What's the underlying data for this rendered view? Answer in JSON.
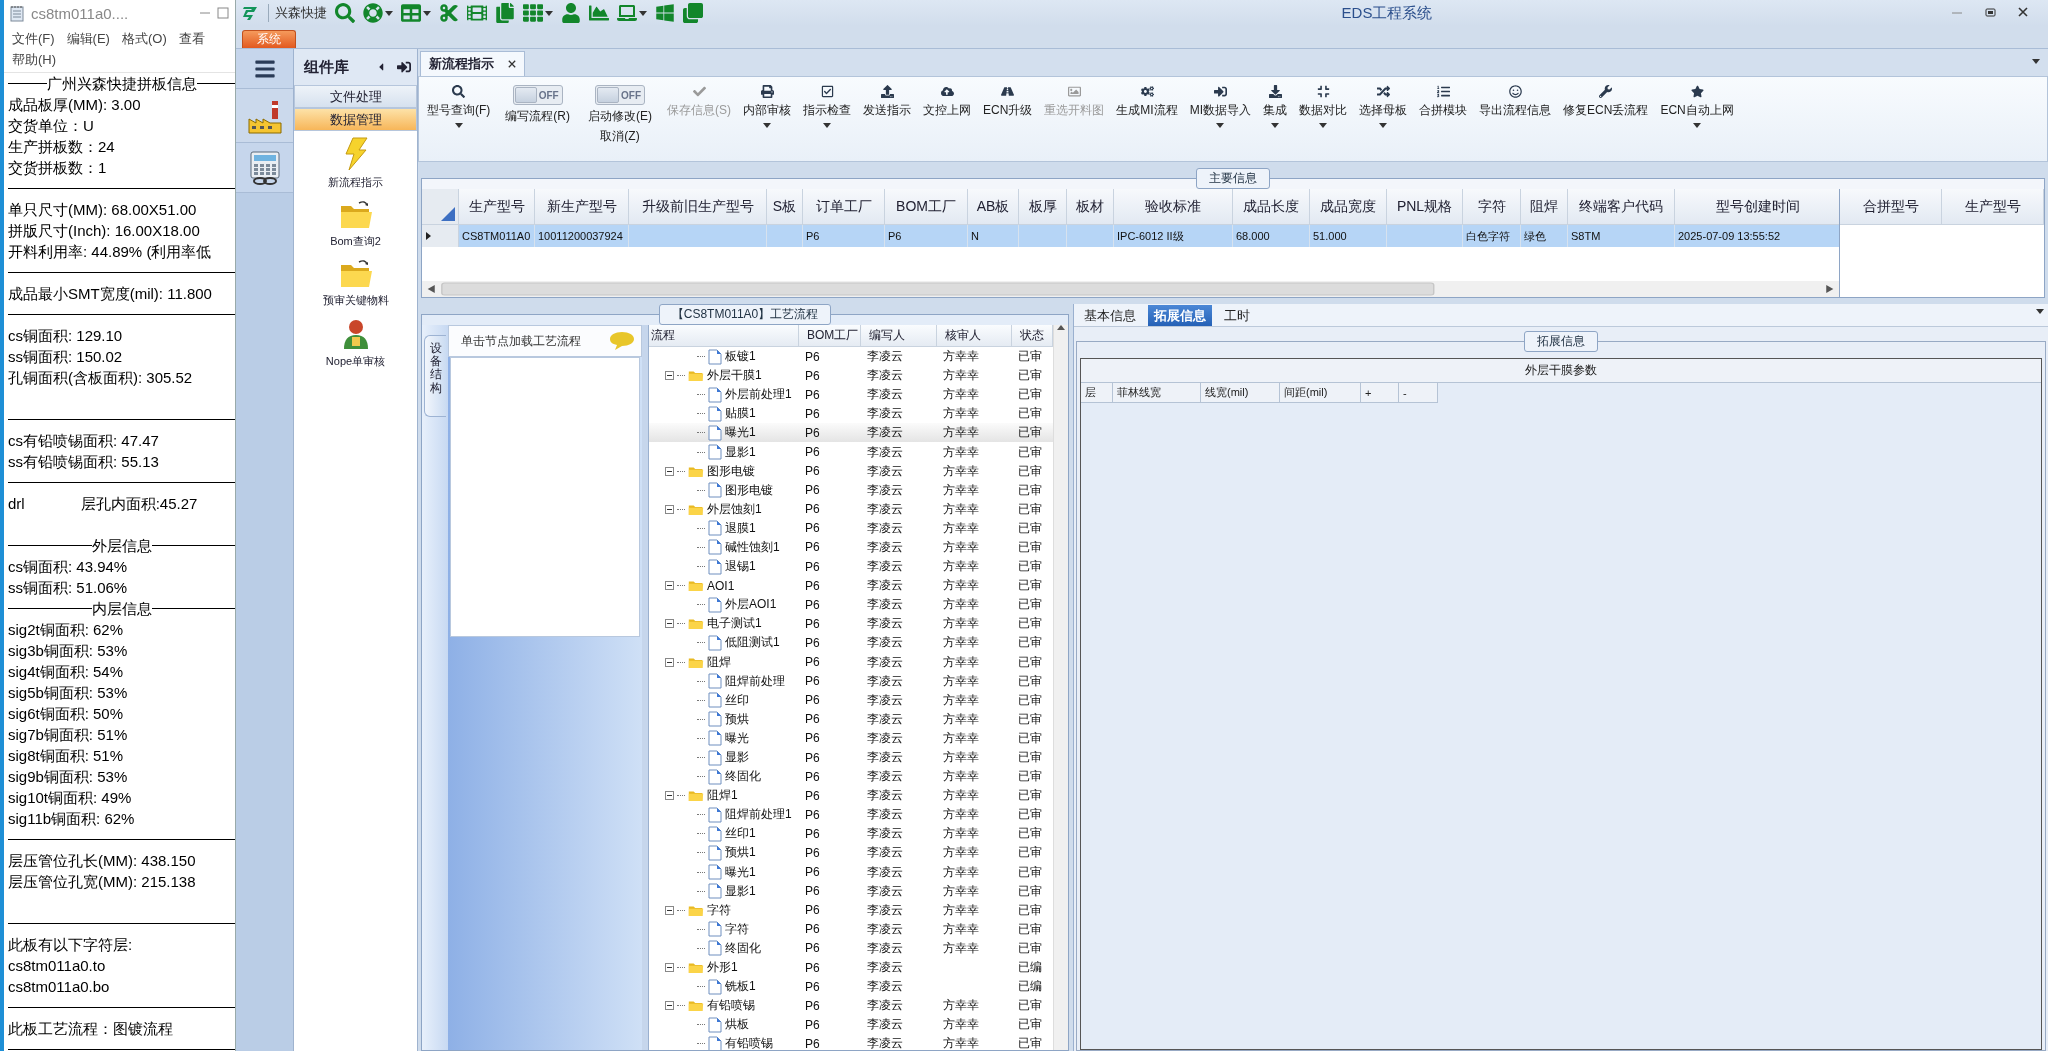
{
  "notepad": {
    "title": "cs8tm011a0....",
    "menu": [
      "文件(F)",
      "编辑(E)",
      "格式(O)",
      "查看",
      "帮助(H)"
    ],
    "lines": [
      {
        "kind": "heading",
        "text": "广州兴森快捷拼板信息"
      },
      {
        "kind": "text",
        "text": "成品板厚(MM): 3.00"
      },
      {
        "kind": "text",
        "text": "交货单位：U"
      },
      {
        "kind": "text",
        "text": "生产拼板数：24"
      },
      {
        "kind": "text",
        "text": "交货拼板数：1"
      },
      {
        "kind": "rule"
      },
      {
        "kind": "text",
        "text": "单只尺寸(MM): 68.00X51.00"
      },
      {
        "kind": "text",
        "text": "拼版尺寸(Inch): 16.00X18.00"
      },
      {
        "kind": "text",
        "text": "开料利用率: 44.89% (利用率低"
      },
      {
        "kind": "rule"
      },
      {
        "kind": "text",
        "text": "成品最小SMT宽度(mil): 11.800"
      },
      {
        "kind": "rule"
      },
      {
        "kind": "text",
        "text": "cs铜面积: 129.10"
      },
      {
        "kind": "text",
        "text": "ss铜面积: 150.02"
      },
      {
        "kind": "text",
        "text": "孔铜面积(含板面积): 305.52"
      },
      {
        "kind": "blank"
      },
      {
        "kind": "rule"
      },
      {
        "kind": "text",
        "text": "cs有铅喷锡面积: 47.47"
      },
      {
        "kind": "text",
        "text": "ss有铅喷锡面积: 55.13"
      },
      {
        "kind": "rule"
      },
      {
        "kind": "pair",
        "text": "drl",
        "value": "层孔内面积:45.27"
      },
      {
        "kind": "blank"
      },
      {
        "kind": "heading",
        "text": "外层信息"
      },
      {
        "kind": "text",
        "text": "cs铜面积: 43.94%"
      },
      {
        "kind": "text",
        "text": "ss铜面积: 51.06%"
      },
      {
        "kind": "heading",
        "text": "内层信息"
      },
      {
        "kind": "text",
        "text": "sig2t铜面积: 62%"
      },
      {
        "kind": "text",
        "text": "sig3b铜面积: 53%"
      },
      {
        "kind": "text",
        "text": "sig4t铜面积: 54%"
      },
      {
        "kind": "text",
        "text": "sig5b铜面积: 53%"
      },
      {
        "kind": "text",
        "text": "sig6t铜面积: 50%"
      },
      {
        "kind": "text",
        "text": "sig7b铜面积: 51%"
      },
      {
        "kind": "text",
        "text": "sig8t铜面积: 51%"
      },
      {
        "kind": "text",
        "text": "sig9b铜面积: 53%"
      },
      {
        "kind": "text",
        "text": "sig10t铜面积: 49%"
      },
      {
        "kind": "text",
        "text": "sig11b铜面积: 62%"
      },
      {
        "kind": "rule"
      },
      {
        "kind": "text",
        "text": "层压管位孔长(MM): 438.150"
      },
      {
        "kind": "text",
        "text": "层压管位孔宽(MM): 215.138"
      },
      {
        "kind": "blank"
      },
      {
        "kind": "rule"
      },
      {
        "kind": "text",
        "text": "此板有以下字符层:"
      },
      {
        "kind": "text",
        "text": "cs8tm011a0.to"
      },
      {
        "kind": "text",
        "text": "cs8tm011a0.bo"
      },
      {
        "kind": "rule"
      },
      {
        "kind": "text",
        "text": "此板工艺流程：图镀流程"
      },
      {
        "kind": "rule"
      }
    ]
  },
  "app": {
    "title": "EDS工程系统",
    "brand": "兴森快捷",
    "system_tab": "系统"
  },
  "component_library": {
    "title": "组件库",
    "groups": [
      {
        "label": "文件处理",
        "selected": false
      },
      {
        "label": "数据管理",
        "selected": true
      }
    ],
    "items": [
      {
        "kind": "lightning",
        "label": "新流程指示"
      },
      {
        "kind": "folder",
        "label": "Bom查询2"
      },
      {
        "kind": "folder",
        "label": "预审关键物料"
      },
      {
        "kind": "person",
        "label": "Nope单审核"
      }
    ]
  },
  "document_tabs": [
    {
      "label": "新流程指示",
      "selected": true
    }
  ],
  "ribbon": [
    {
      "kind": "button",
      "label": "型号查询(F)",
      "dropdown": true,
      "disabled": false
    },
    {
      "kind": "toggle",
      "switch_text": "OFF",
      "on": false,
      "label": "编写流程(R)"
    },
    {
      "kind": "toggle",
      "switch_text": "OFF",
      "on": false,
      "label": "启动修改(E)",
      "second_label": "取消(Z)"
    },
    {
      "kind": "button",
      "label": "保存信息(S)",
      "dropdown": false,
      "disabled": true
    },
    {
      "kind": "button",
      "label": "内部审核",
      "dropdown": true,
      "disabled": false
    },
    {
      "kind": "button",
      "label": "指示检查",
      "dropdown": true,
      "disabled": false
    },
    {
      "kind": "button",
      "label": "发送指示",
      "dropdown": false,
      "disabled": false
    },
    {
      "kind": "button",
      "label": "文控上网",
      "dropdown": false,
      "disabled": false
    },
    {
      "kind": "button",
      "label": "ECN升级",
      "dropdown": false,
      "disabled": false
    },
    {
      "kind": "button",
      "label": "重选开料图",
      "dropdown": false,
      "disabled": true
    },
    {
      "kind": "button",
      "label": "生成MI流程",
      "dropdown": false,
      "disabled": false
    },
    {
      "kind": "button",
      "label": "MI数据导入",
      "dropdown": true,
      "disabled": false
    },
    {
      "kind": "button",
      "label": "集成",
      "dropdown": true,
      "disabled": false
    },
    {
      "kind": "button",
      "label": "数据对比",
      "dropdown": true,
      "disabled": false
    },
    {
      "kind": "button",
      "label": "选择母板",
      "dropdown": true,
      "disabled": false
    },
    {
      "kind": "button",
      "label": "合拼模块",
      "dropdown": false,
      "disabled": false
    },
    {
      "kind": "button",
      "label": "导出流程信息",
      "dropdown": false,
      "disabled": false
    },
    {
      "kind": "button",
      "label": "修复ECN丢流程",
      "dropdown": false,
      "disabled": false
    },
    {
      "kind": "button",
      "label": "ECN自动上网",
      "dropdown": true,
      "disabled": false
    }
  ],
  "main_info": {
    "legend": "主要信息",
    "columns": [
      "生产型号",
      "新生产型号",
      "升级前旧生产型号",
      "S板",
      "订单工厂",
      "BOM工厂",
      "AB板",
      "板厚",
      "板材",
      "验收标准",
      "成品长度",
      "成品宽度",
      "PNL规格",
      "字符",
      "阻焊",
      "终端客户代码",
      "型号创建时间"
    ],
    "rows": [
      {
        "selected": true,
        "cells": [
          "CS8TM011A0",
          "10011200037924",
          null,
          null,
          "P6",
          "P6",
          "N",
          null,
          null,
          "IPC-6012 II级",
          "68.000",
          "51.000",
          null,
          "白色字符",
          "绿色",
          "S8TM",
          "2025-07-09 13:55:52"
        ]
      }
    ],
    "side_columns": [
      "合拼型号",
      "生产型号"
    ]
  },
  "flow": {
    "legend": "【CS8TM011A0】工艺流程",
    "side_tab": "设备结构",
    "hint": "单击节点加载工艺流程",
    "columns": [
      "流程",
      "BOM工厂",
      "编写人",
      "核审人",
      "状态"
    ],
    "tree": [
      {
        "kind": "continued",
        "children": [
          {
            "kind": "file",
            "label": "板镀1",
            "bom": "P6",
            "writer": "李凌云",
            "reviewer": "方幸幸",
            "status": "已审",
            "selected": false
          }
        ]
      },
      {
        "kind": "folder",
        "label": "外层干膜1",
        "bom": "P6",
        "writer": "李凌云",
        "reviewer": "方幸幸",
        "status": "已审",
        "expanded": true,
        "selected": false,
        "children": [
          {
            "kind": "file",
            "label": "外层前处理1",
            "bom": "P6",
            "writer": "李凌云",
            "reviewer": "方幸幸",
            "status": "已审",
            "selected": false
          },
          {
            "kind": "file",
            "label": "贴膜1",
            "bom": "P6",
            "writer": "李凌云",
            "reviewer": "方幸幸",
            "status": "已审",
            "selected": false
          },
          {
            "kind": "file",
            "label": "曝光1",
            "bom": "P6",
            "writer": "李凌云",
            "reviewer": "方幸幸",
            "status": "已审",
            "selected": true
          },
          {
            "kind": "file",
            "label": "显影1",
            "bom": "P6",
            "writer": "李凌云",
            "reviewer": "方幸幸",
            "status": "已审",
            "selected": false
          }
        ]
      },
      {
        "kind": "folder",
        "label": "图形电镀",
        "bom": "P6",
        "writer": "李凌云",
        "reviewer": "方幸幸",
        "status": "已审",
        "expanded": true,
        "selected": false,
        "children": [
          {
            "kind": "file",
            "label": "图形电镀",
            "bom": "P6",
            "writer": "李凌云",
            "reviewer": "方幸幸",
            "status": "已审",
            "selected": false
          }
        ]
      },
      {
        "kind": "folder",
        "label": "外层蚀刻1",
        "bom": "P6",
        "writer": "李凌云",
        "reviewer": "方幸幸",
        "status": "已审",
        "expanded": true,
        "selected": false,
        "children": [
          {
            "kind": "file",
            "label": "退膜1",
            "bom": "P6",
            "writer": "李凌云",
            "reviewer": "方幸幸",
            "status": "已审",
            "selected": false
          },
          {
            "kind": "file",
            "label": "碱性蚀刻1",
            "bom": "P6",
            "writer": "李凌云",
            "reviewer": "方幸幸",
            "status": "已审",
            "selected": false
          },
          {
            "kind": "file",
            "label": "退锡1",
            "bom": "P6",
            "writer": "李凌云",
            "reviewer": "方幸幸",
            "status": "已审",
            "selected": false
          }
        ]
      },
      {
        "kind": "folder",
        "label": "AOI1",
        "bom": "P6",
        "writer": "李凌云",
        "reviewer": "方幸幸",
        "status": "已审",
        "expanded": true,
        "selected": false,
        "children": [
          {
            "kind": "file",
            "label": "外层AOI1",
            "bom": "P6",
            "writer": "李凌云",
            "reviewer": "方幸幸",
            "status": "已审",
            "selected": false
          }
        ]
      },
      {
        "kind": "folder",
        "label": "电子测试1",
        "bom": "P6",
        "writer": "李凌云",
        "reviewer": "方幸幸",
        "status": "已审",
        "expanded": true,
        "selected": false,
        "children": [
          {
            "kind": "file",
            "label": "低阻测试1",
            "bom": "P6",
            "writer": "李凌云",
            "reviewer": "方幸幸",
            "status": "已审",
            "selected": false
          }
        ]
      },
      {
        "kind": "folder",
        "label": "阻焊",
        "bom": "P6",
        "writer": "李凌云",
        "reviewer": "方幸幸",
        "status": "已审",
        "expanded": true,
        "selected": false,
        "children": [
          {
            "kind": "file",
            "label": "阻焊前处理",
            "bom": "P6",
            "writer": "李凌云",
            "reviewer": "方幸幸",
            "status": "已审",
            "selected": false
          },
          {
            "kind": "file",
            "label": "丝印",
            "bom": "P6",
            "writer": "李凌云",
            "reviewer": "方幸幸",
            "status": "已审",
            "selected": false
          },
          {
            "kind": "file",
            "label": "预烘",
            "bom": "P6",
            "writer": "李凌云",
            "reviewer": "方幸幸",
            "status": "已审",
            "selected": false
          },
          {
            "kind": "file",
            "label": "曝光",
            "bom": "P6",
            "writer": "李凌云",
            "reviewer": "方幸幸",
            "status": "已审",
            "selected": false
          },
          {
            "kind": "file",
            "label": "显影",
            "bom": "P6",
            "writer": "李凌云",
            "reviewer": "方幸幸",
            "status": "已审",
            "selected": false
          },
          {
            "kind": "file",
            "label": "终固化",
            "bom": "P6",
            "writer": "李凌云",
            "reviewer": "方幸幸",
            "status": "已审",
            "selected": false
          }
        ]
      },
      {
        "kind": "folder",
        "label": "阻焊1",
        "bom": "P6",
        "writer": "李凌云",
        "reviewer": "方幸幸",
        "status": "已审",
        "expanded": true,
        "selected": false,
        "children": [
          {
            "kind": "file",
            "label": "阻焊前处理1",
            "bom": "P6",
            "writer": "李凌云",
            "reviewer": "方幸幸",
            "status": "已审",
            "selected": false
          },
          {
            "kind": "file",
            "label": "丝印1",
            "bom": "P6",
            "writer": "李凌云",
            "reviewer": "方幸幸",
            "status": "已审",
            "selected": false
          },
          {
            "kind": "file",
            "label": "预烘1",
            "bom": "P6",
            "writer": "李凌云",
            "reviewer": "方幸幸",
            "status": "已审",
            "selected": false
          },
          {
            "kind": "file",
            "label": "曝光1",
            "bom": "P6",
            "writer": "李凌云",
            "reviewer": "方幸幸",
            "status": "已审",
            "selected": false
          },
          {
            "kind": "file",
            "label": "显影1",
            "bom": "P6",
            "writer": "李凌云",
            "reviewer": "方幸幸",
            "status": "已审",
            "selected": false
          }
        ]
      },
      {
        "kind": "folder",
        "label": "字符",
        "bom": "P6",
        "writer": "李凌云",
        "reviewer": "方幸幸",
        "status": "已审",
        "expanded": true,
        "selected": false,
        "children": [
          {
            "kind": "file",
            "label": "字符",
            "bom": "P6",
            "writer": "李凌云",
            "reviewer": "方幸幸",
            "status": "已审",
            "selected": false
          },
          {
            "kind": "file",
            "label": "终固化",
            "bom": "P6",
            "writer": "李凌云",
            "reviewer": "方幸幸",
            "status": "已审",
            "selected": false
          }
        ]
      },
      {
        "kind": "folder",
        "label": "外形1",
        "bom": "P6",
        "writer": "李凌云",
        "status": "已编",
        "expanded": true,
        "selected": false,
        "children": [
          {
            "kind": "file",
            "label": "铣板1",
            "bom": "P6",
            "writer": "李凌云",
            "status": "已编",
            "selected": false
          }
        ]
      },
      {
        "kind": "folder",
        "label": "有铅喷锡",
        "bom": "P6",
        "writer": "李凌云",
        "reviewer": "方幸幸",
        "status": "已审",
        "expanded": true,
        "selected": false,
        "children": [
          {
            "kind": "file",
            "label": "烘板",
            "bom": "P6",
            "writer": "李凌云",
            "reviewer": "方幸幸",
            "status": "已审",
            "selected": false
          },
          {
            "kind": "file",
            "label": "有铅喷锡",
            "bom": "P6",
            "writer": "李凌云",
            "reviewer": "方幸幸",
            "status": "已审",
            "selected": false
          }
        ]
      }
    ]
  },
  "detail": {
    "tabs": [
      {
        "label": "基本信息",
        "selected": false
      },
      {
        "label": "拓展信息",
        "selected": true
      },
      {
        "label": "工时",
        "selected": false
      }
    ],
    "legend": "拓展信息",
    "table_title": "外层干膜参数",
    "columns": [
      "层",
      "菲林线宽",
      "线宽(mil)",
      "间距(mil)",
      "+",
      "-"
    ]
  }
}
